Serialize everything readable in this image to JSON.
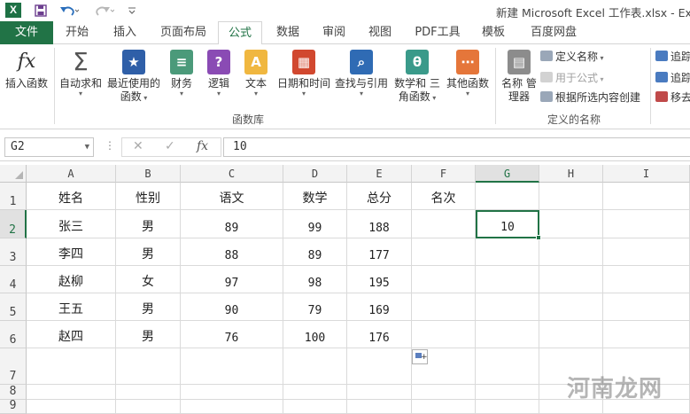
{
  "titlebar": {
    "app_icon": "excel-logo",
    "app_letter": "X",
    "quick_access": [
      "save-icon",
      "undo-icon",
      "redo-icon",
      "customize-icon"
    ],
    "title": "新建 Microsoft Excel 工作表.xlsx - Exc"
  },
  "tabs": {
    "file": "文件",
    "items": [
      "开始",
      "插入",
      "页面布局",
      "公式",
      "数据",
      "审阅",
      "视图",
      "PDF工具",
      "模板",
      "百度网盘"
    ],
    "active": "公式"
  },
  "ribbon": {
    "insert_function": "插入函数",
    "insert_function_glyph": "fx",
    "autosum": "自动求和",
    "recent": [
      "最近使用的",
      "函数"
    ],
    "financial": "财务",
    "logical": "逻辑",
    "text": "文本",
    "datetime": "日期和时间",
    "lookup": "查找与引用",
    "math": [
      "数学和",
      "三角函数"
    ],
    "more": "其他函数",
    "library_group": "函数库",
    "name_manager": [
      "名称",
      "管理器"
    ],
    "define_name": "定义名称",
    "use_in_formula": "用于公式",
    "create_from_selection": "根据所选内容创建",
    "names_group": "定义的名称",
    "trace_precedents": "追踪",
    "trace_dependents": "追踪",
    "remove_arrows": "移去"
  },
  "formula_bar": {
    "name_box": "G2",
    "cancel_icon": "close-icon",
    "enter_icon": "check-icon",
    "fx": "fx",
    "value": "10"
  },
  "sheet": {
    "columns": [
      "A",
      "B",
      "C",
      "D",
      "E",
      "F",
      "G",
      "H",
      "I"
    ],
    "selected_column": "G",
    "rows": [
      "1",
      "2",
      "3",
      "4",
      "5",
      "6",
      "7",
      "8",
      "9"
    ],
    "selected_row": "2",
    "headers": [
      "姓名",
      "性别",
      "语文",
      "数学",
      "总分",
      "名次"
    ],
    "data": [
      [
        "张三",
        "男",
        "89",
        "99",
        "188"
      ],
      [
        "李四",
        "男",
        "88",
        "89",
        "177"
      ],
      [
        "赵柳",
        "女",
        "97",
        "98",
        "195"
      ],
      [
        "王五",
        "男",
        "90",
        "79",
        "169"
      ],
      [
        "赵四",
        "男",
        "76",
        "100",
        "176"
      ]
    ],
    "g2_value": "10"
  },
  "accent_color": "#217346",
  "watermark": "河南龙网"
}
